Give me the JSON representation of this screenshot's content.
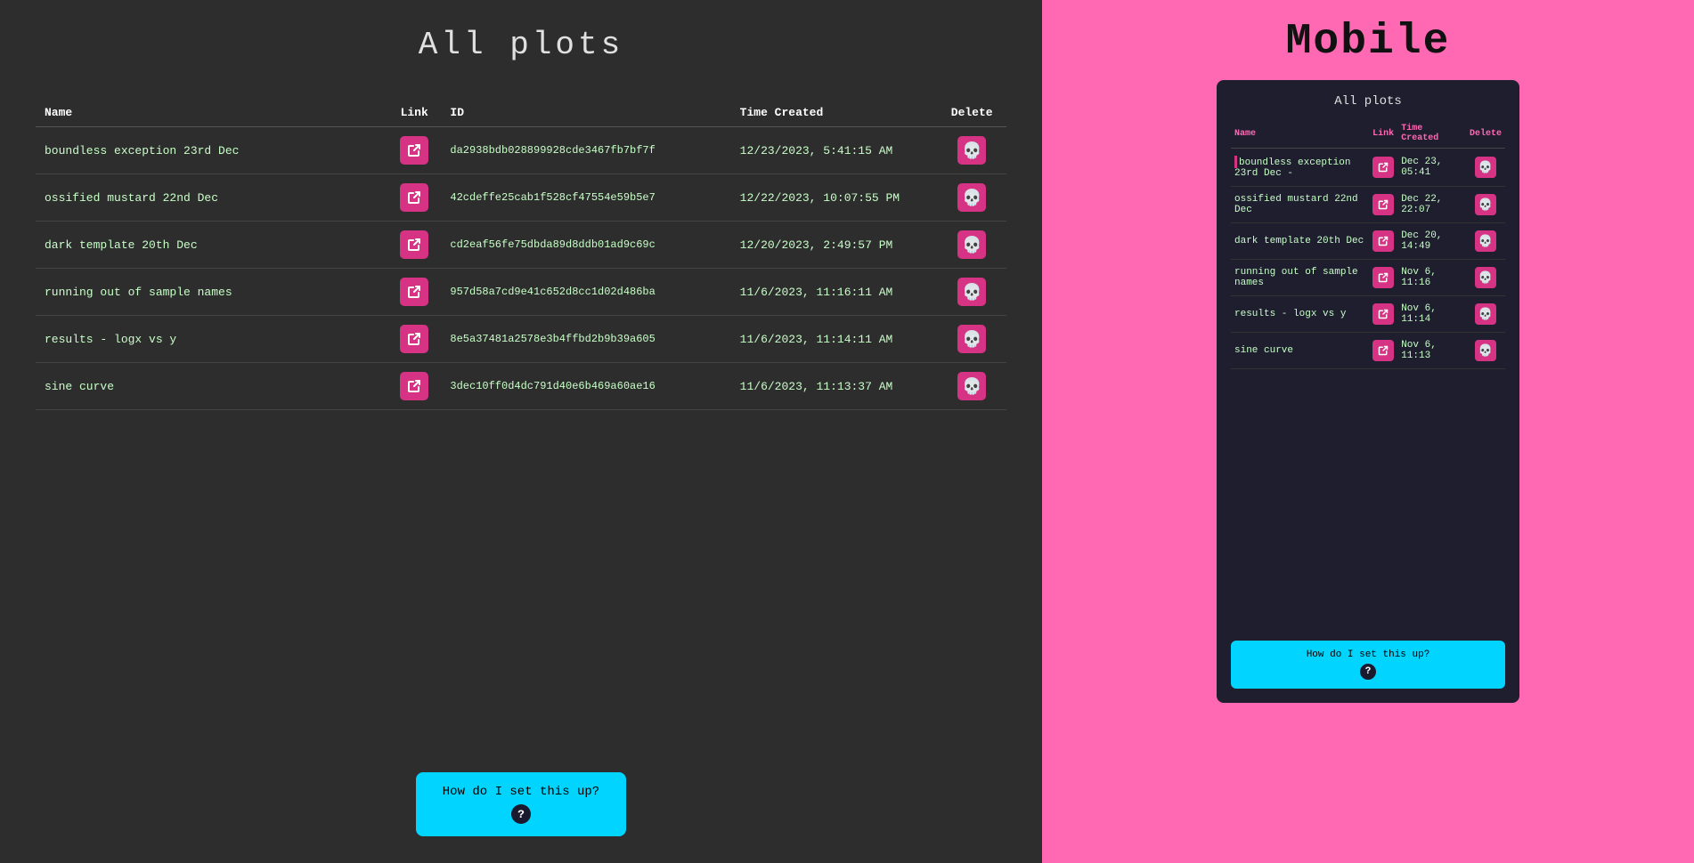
{
  "left": {
    "title": "All plots",
    "table": {
      "headers": {
        "name": "Name",
        "link": "Link",
        "id": "ID",
        "time_created": "Time Created",
        "delete": "Delete"
      },
      "rows": [
        {
          "name": "boundless exception 23rd Dec",
          "id": "da2938bdb028899928cde3467fb7bf7f",
          "time_created": "12/23/2023, 5:41:15 AM"
        },
        {
          "name": "ossified mustard 22nd Dec",
          "id": "42cdeffe25cab1f528cf47554e59b5e7",
          "time_created": "12/22/2023, 10:07:55 PM"
        },
        {
          "name": "dark template 20th Dec",
          "id": "cd2eaf56fe75dbda89d8ddb01ad9c69c",
          "time_created": "12/20/2023, 2:49:57 PM"
        },
        {
          "name": "running out of sample names",
          "id": "957d58a7cd9e41c652d8cc1d02d486ba",
          "time_created": "11/6/2023, 11:16:11 AM"
        },
        {
          "name": "results - logx vs y",
          "id": "8e5a37481a2578e3b4ffbd2b9b39a605",
          "time_created": "11/6/2023, 11:14:11 AM"
        },
        {
          "name": "sine curve",
          "id": "3dec10ff0d4dc791d40e6b469a60ae16",
          "time_created": "11/6/2023, 11:13:37 AM"
        }
      ]
    },
    "help_button": "How do I set this up?"
  },
  "right": {
    "title": "Mobile",
    "subtitle": "All plots",
    "table": {
      "headers": {
        "name": "Name",
        "link": "Link",
        "time_created": "Time\nCreated",
        "delete": "Delete"
      },
      "rows": [
        {
          "name": "boundless exception 23rd Dec -",
          "time": "Dec 23, 05:41"
        },
        {
          "name": "ossified mustard 22nd Dec",
          "time": "Dec 22, 22:07"
        },
        {
          "name": "dark template 20th Dec",
          "time": "Dec 20, 14:49"
        },
        {
          "name": "running out of sample names",
          "time": "Nov 6, 11:16"
        },
        {
          "name": "results - logx vs y",
          "time": "Nov 6, 11:14"
        },
        {
          "name": "sine curve",
          "time": "Nov 6, 11:13"
        }
      ]
    },
    "help_button": "How do I set this up?"
  }
}
